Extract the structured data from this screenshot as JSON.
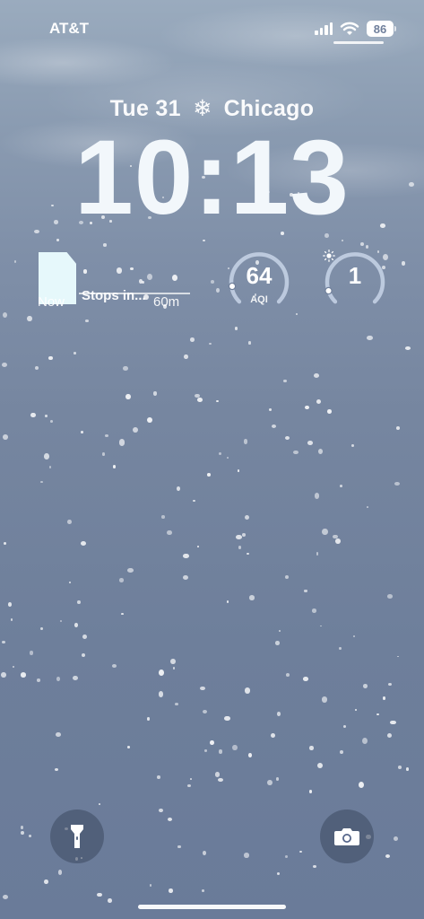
{
  "status_bar": {
    "carrier": "AT&T",
    "battery": "86",
    "icons": [
      "cellular-signal-icon",
      "wifi-icon",
      "battery-icon"
    ]
  },
  "lock_screen": {
    "date": "Tue 31",
    "weather_icon": "snowflake-icon",
    "city": "Chicago",
    "time": "10:13"
  },
  "widgets": {
    "precipitation": {
      "now_label": "Now",
      "stops_label": "Stops in...",
      "end_label": "60m"
    },
    "aqi": {
      "value": "64",
      "label": "AQI",
      "level_fraction": 0.28
    },
    "uv": {
      "value": "1",
      "icon": "sun-icon",
      "level_fraction": 0.08
    }
  },
  "quick_actions": {
    "flashlight": "flashlight-icon",
    "camera": "camera-icon"
  },
  "colors": {
    "background_top": "#9aabbe",
    "background_bottom": "#6a7b99",
    "text": "#ffffff",
    "widget_accent": "#e6f8fb"
  }
}
